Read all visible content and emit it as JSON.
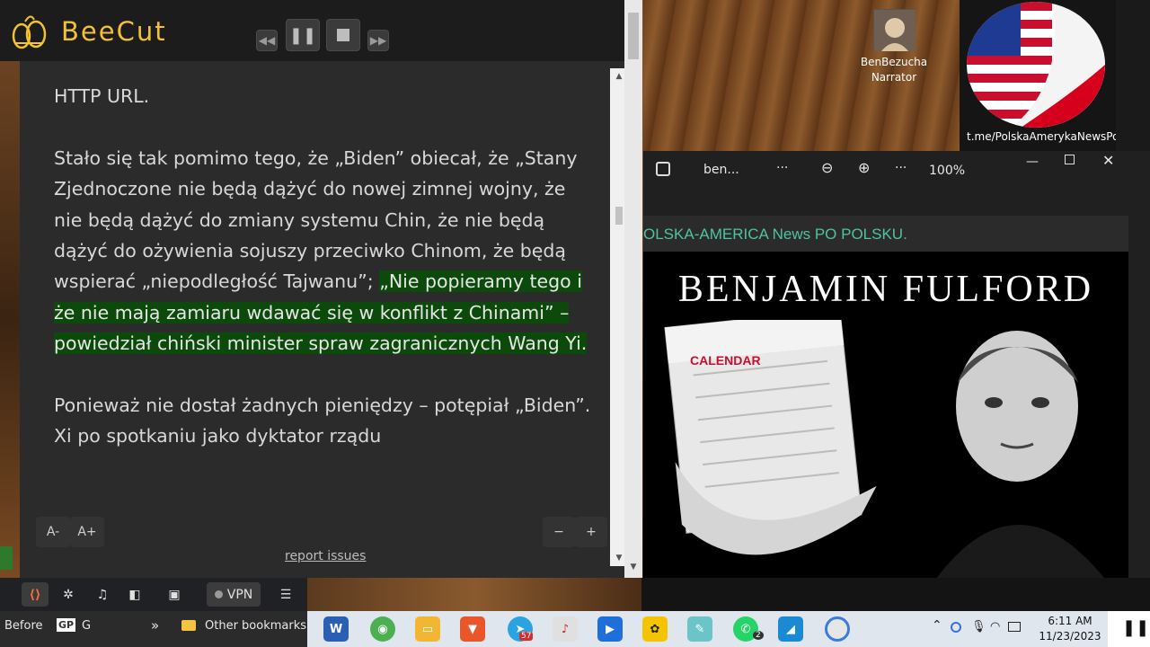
{
  "app": {
    "title": "BeeCut"
  },
  "reader": {
    "paragraphs": [
      {
        "text": "HTTP URL."
      },
      {
        "before": "Stało się tak pomimo tego, że „Biden” obiecał, że „Stany Zjednoczone nie będą dążyć do nowej zimnej wojny, że nie będą dążyć do zmiany systemu Chin, że nie będą dążyć do ożywienia sojuszy przeciwko Chinom, że będą wspierać „niepodległość Tajwanu”; ",
        "highlight": "„Nie popieramy tego i że nie mają zamiaru wdawać się w konflikt z Chinami” – powiedział chiński minister spraw zagranicznych Wang Yi."
      },
      {
        "text": "Ponieważ nie dostał żadnych pieniędzy – potępiał „Biden”. Xi po spotkaniu jako dyktator rządu"
      }
    ],
    "font_decrease": "A-",
    "font_increase": "A+",
    "minus": "−",
    "plus": "+",
    "report_link": "report issues"
  },
  "narrator": {
    "name": "BenBezucha",
    "role": "Narrator"
  },
  "channel_url": "t.me/PolskaAmerykaNewsPo",
  "viewer": {
    "filename": "ben...",
    "more": "···",
    "zoom": "100%",
    "banner": "OLSKA-AMERICA News PO POLSKU.",
    "headline": "BENJAMIN FULFORD",
    "calendar_label": "CALENDAR"
  },
  "browser_bar": {
    "vpn": "VPN"
  },
  "bookmarks": {
    "before": "Before",
    "gp": "GP",
    "g": "G",
    "more": "»",
    "other": "Other bookmarks"
  },
  "taskbar": {
    "telegram_badge": "57",
    "whatsapp_badge": "2"
  },
  "clock": {
    "time": "6:11 AM",
    "date": "11/23/2023"
  },
  "colors": {
    "accent": "#f2c233",
    "highlight": "#0c4a0c",
    "banner": "#4fc3a1"
  }
}
